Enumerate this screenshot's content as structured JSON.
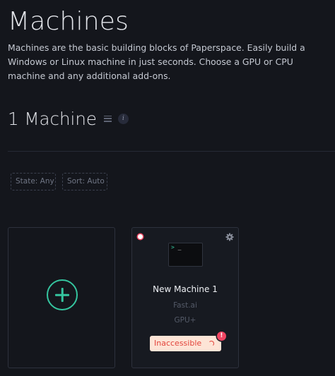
{
  "header": {
    "title": "Machines",
    "description": "Machines are the basic building blocks of Paperspace. Easily build a Windows or Linux machine in just seconds. Choose a GPU or CPU machine and any additional add-ons."
  },
  "summary": {
    "count_label": "1 Machine",
    "info_glyph": "i"
  },
  "filters": {
    "state": "State: Any",
    "sort": "Sort: Auto"
  },
  "create_card": {
    "icon": "plus-circle-icon"
  },
  "machines": [
    {
      "name": "New Machine 1",
      "template": "Fast.ai",
      "type": "GPU+",
      "status": "Inaccessible",
      "terminal_prompt": ">",
      "terminal_cursor": "_",
      "alert": "!"
    }
  ],
  "colors": {
    "background": "#14161c",
    "accent": "#35c59f",
    "error": "#ef4562",
    "status_bg": "#fde4d6"
  }
}
